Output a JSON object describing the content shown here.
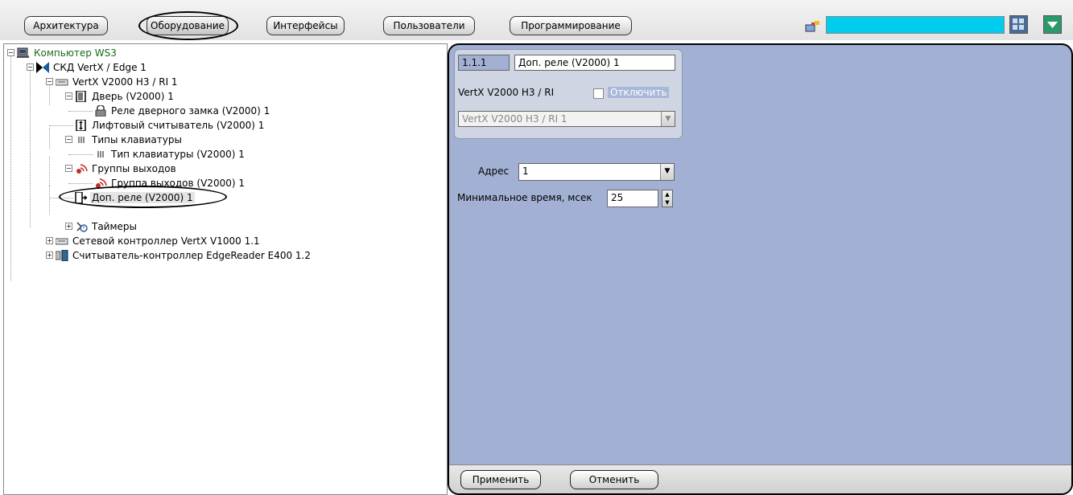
{
  "toolbar": {
    "tabs": [
      {
        "label": "Архитектура",
        "active": false
      },
      {
        "label": "Оборудование",
        "active": true
      },
      {
        "label": "Интерфейсы",
        "active": false
      },
      {
        "label": "Пользователи",
        "active": false
      },
      {
        "label": "Программирование",
        "active": false
      }
    ],
    "icons": [
      "monitor-flag-icon",
      "grid-view-icon",
      "dropdown-arrow-icon"
    ],
    "cyan_color": "#00ccee"
  },
  "tree": {
    "nodes": [
      {
        "label": "Компьютер WS3",
        "icon": "computer-icon",
        "color": "#1a6b1a"
      },
      {
        "label": "СКД VertX / Edge 1",
        "icon": "access-control-icon"
      },
      {
        "label": "VertX V2000 H3 / RI 1",
        "icon": "controller-icon"
      },
      {
        "label": "Дверь (V2000) 1",
        "icon": "door-icon"
      },
      {
        "label": "Реле дверного замка (V2000) 1",
        "icon": "lock-icon"
      },
      {
        "label": "Лифтовый считыватель (V2000) 1",
        "icon": "elevator-reader-icon"
      },
      {
        "label": "Типы клавиатуры",
        "icon": "keypad-icon"
      },
      {
        "label": "Тип клавиатуры (V2000) 1",
        "icon": "keypad-icon"
      },
      {
        "label": "Группы выходов",
        "icon": "output-group-icon"
      },
      {
        "label": "Группа выходов (V2000) 1",
        "icon": "output-group-icon"
      },
      {
        "label": "Доп. реле (V2000) 1",
        "icon": "relay-icon"
      },
      {
        "label": "Таймеры",
        "icon": "timer-icon"
      },
      {
        "label": "Сетевой контроллер VertX V1000 1.1",
        "icon": "controller-icon"
      },
      {
        "label": "Считыватель-контроллер EdgeReader E400 1.2",
        "icon": "reader-icon"
      }
    ]
  },
  "panel": {
    "id": "1.1.1",
    "name": "Доп. реле (V2000) 1",
    "parent_label": "VertX V2000 H3 / RI",
    "disable_label": "Отключить",
    "parent_select": "VertX V2000 H3 / RI 1",
    "address_label": "Адрес",
    "address_value": "1",
    "min_time_label": "Минимальное время, мсек",
    "min_time_value": "25",
    "apply_label": "Применить",
    "cancel_label": "Отменить"
  }
}
